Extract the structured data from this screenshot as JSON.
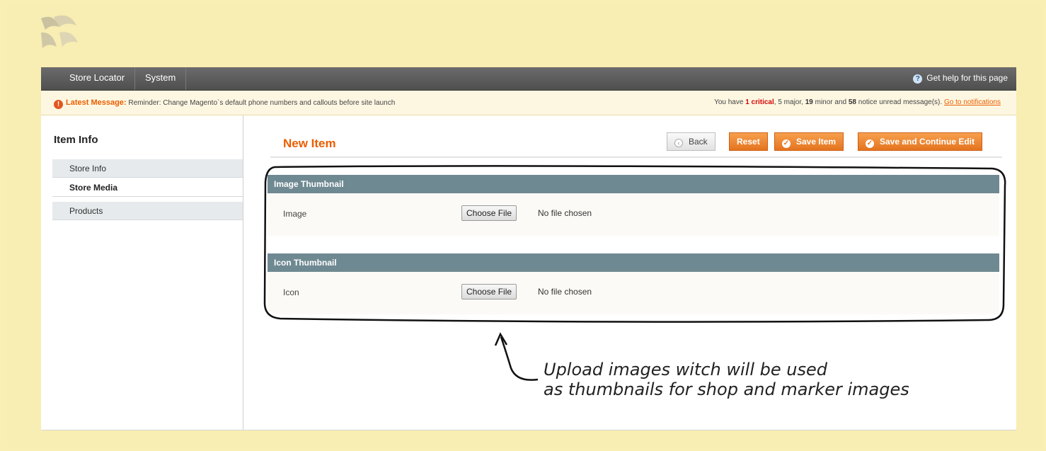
{
  "topnav": {
    "items": [
      "Store Locator",
      "System"
    ],
    "help_label": "Get help for this page"
  },
  "message_bar": {
    "latest_label": "Latest Message:",
    "latest_text": "Reminder: Change Magento`s default phone numbers and callouts before site launch",
    "summary_prefix": "You have",
    "critical": "1 critical",
    "major": "5 major,",
    "minor_count": "19",
    "minor_text": "minor and",
    "notice_count": "58",
    "notice_text": "notice unread message(s).",
    "notifications_link": "Go to notifications"
  },
  "sidebar": {
    "title": "Item Info",
    "tabs": [
      {
        "label": "Store Info",
        "state": "default"
      },
      {
        "label": "Store Media",
        "state": "active"
      },
      {
        "label": "Products",
        "state": "default"
      }
    ]
  },
  "main": {
    "title": "New Item",
    "buttons": {
      "back": "Back",
      "reset": "Reset",
      "save": "Save Item",
      "save_continue": "Save and Continue Edit"
    },
    "sections": [
      {
        "title": "Image Thumbnail",
        "field_label": "Image",
        "file_button": "Choose File",
        "file_status": "No file chosen"
      },
      {
        "title": "Icon Thumbnail",
        "field_label": "Icon",
        "file_button": "Choose File",
        "file_status": "No file chosen"
      }
    ]
  },
  "annotation": {
    "line1": "Upload images witch will be used",
    "line2": "as thumbnails for shop and marker images"
  },
  "colors": {
    "background": "#f9eeb4",
    "accent": "#eb5e00",
    "section_header": "#6f8992",
    "nav": "#555555"
  }
}
